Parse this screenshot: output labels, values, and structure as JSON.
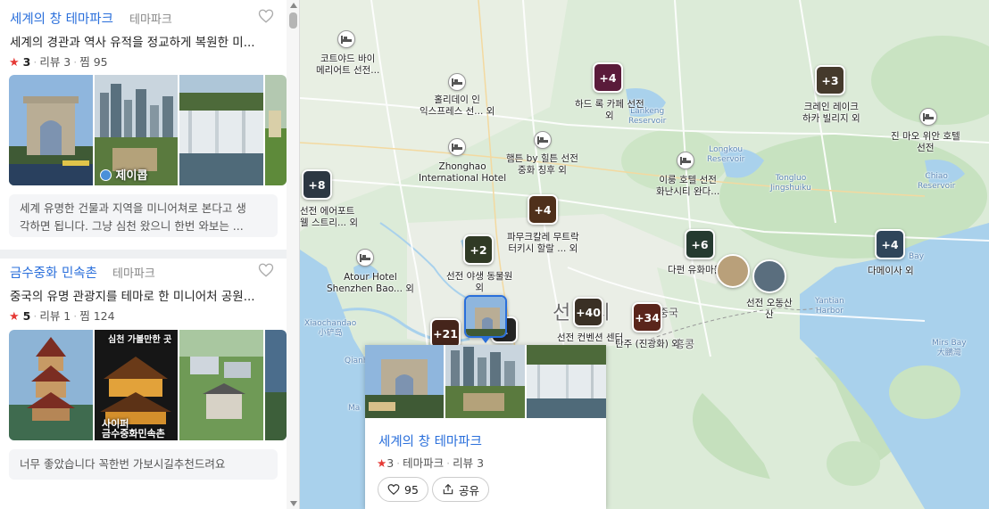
{
  "places": [
    {
      "name": "세계의 창 테마파크",
      "category": "테마파크",
      "description": "세계의 경관과 역사 유적을 정교하게 복원한 미...",
      "rating": "3",
      "reviews": "리뷰 3",
      "saves": "찜 95",
      "photo_overlay": "제이콥",
      "review_line1": "세계 유명한 건물과 지역을 미니어쳐로 본다고 생",
      "review_line2": "각하면 됩니다. 그냥 심천 왔으니 한번 와보는 ..."
    },
    {
      "name": "금수중화 민속촌",
      "category": "테마파크",
      "description": "중국의 유명 관광지를 테마로 한 미니어처 공원...",
      "rating": "5",
      "reviews": "리뷰 1",
      "saves": "찜 124",
      "photo_banner": "심천 가볼만한 곳",
      "photo_overlay": "금수중화민속촌",
      "photo_overlay_top": "사이퍼",
      "review_line1": "너무 좋았습니다 꼭한번 가보시길추천드려요"
    }
  ],
  "map": {
    "city_label": "선전시",
    "country_label": "중국",
    "hk_label": "홍콩",
    "hotels": [
      {
        "name": "코트야드 바이\n메리어트 선전..."
      },
      {
        "name": "홀리데이 인\n익스프레스 선... 외"
      },
      {
        "name": "Zhonghao\nInternational Hotel"
      },
      {
        "name": "햄튼 by 힐튼 선전\n중화 칭후 외"
      },
      {
        "name": "Atour Hotel\nShenzhen Bao... 외"
      },
      {
        "name": "이룽 호텔 선전\n화난시티 완다..."
      },
      {
        "name": "진 마오 위안 호텔\n선전"
      }
    ],
    "clusters": [
      {
        "count": "+4",
        "label": "하드 록 카페 선전\n외"
      },
      {
        "count": "+3",
        "label": "크레인 레이크\n하카 빌리지 외"
      },
      {
        "count": "+8",
        "label": "선전 에어포트\n웰 스트리... 외"
      },
      {
        "count": "+4",
        "label": "파무크칼레 무트락\n터키시 할랄 ... 외"
      },
      {
        "count": "+2",
        "label": "선전 야생 동물원\n외"
      },
      {
        "count": "+6",
        "label": "다펀 유화마을"
      },
      {
        "count": "+4",
        "label": "다메이사 외"
      },
      {
        "count": "+40",
        "label": "선전 컨벤션 센터"
      },
      {
        "count": "+34",
        "label": "탄주 (진광화) 외"
      },
      {
        "count": "+21",
        "label": ""
      },
      {
        "count": "1",
        "label": ""
      }
    ],
    "photo_markers": [
      {
        "label": "선전 오동산\n산"
      }
    ],
    "water_labels": [
      "Lankeng\nReservoir",
      "Longkou\nReservoir",
      "Tongluo\nJingshuiku",
      "Chiao\nReservoir",
      "Xiaochandao\n小铲岛",
      "Qianhai",
      "Yantian\nHarbor",
      "Mirs Bay\n大鵬灣",
      "Bay",
      "Ma"
    ]
  },
  "popup": {
    "name": "세계의 창 테마파크",
    "rating": "3",
    "category": "테마파크",
    "reviews": "리뷰 3",
    "like_count": "95",
    "share_label": "공유"
  },
  "colors": {
    "accent": "#2a6fdb",
    "star": "#e53935",
    "water": "#a9d1ec",
    "land": "#dcebd8"
  }
}
